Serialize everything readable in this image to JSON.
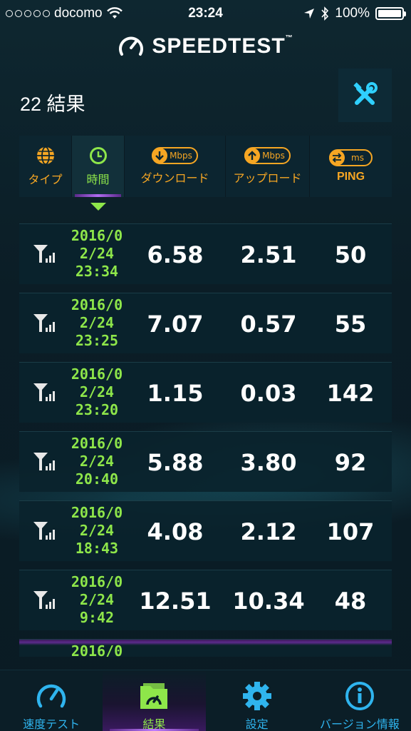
{
  "status_bar": {
    "carrier": "docomo",
    "time": "23:24",
    "battery": "100%"
  },
  "header": {
    "brand": "SPEEDTEST",
    "tm": "™",
    "result_count": "22 結果"
  },
  "columns": [
    {
      "label": "タイプ",
      "icon": "globe-icon"
    },
    {
      "label": "時間",
      "icon": "clock-icon",
      "active": true
    },
    {
      "label": "ダウンロード",
      "icon": "download-icon",
      "unit": "Mbps"
    },
    {
      "label": "アップロード",
      "icon": "upload-icon",
      "unit": "Mbps"
    },
    {
      "label": "PING",
      "icon": "ping-icon",
      "unit": "ms"
    }
  ],
  "results": [
    {
      "date1": "2016/0",
      "date2": "2/24",
      "time": "23:34",
      "download": "6.58",
      "upload": "2.51",
      "ping": "50"
    },
    {
      "date1": "2016/0",
      "date2": "2/24",
      "time": "23:25",
      "download": "7.07",
      "upload": "0.57",
      "ping": "55"
    },
    {
      "date1": "2016/0",
      "date2": "2/24",
      "time": "23:20",
      "download": "1.15",
      "upload": "0.03",
      "ping": "142"
    },
    {
      "date1": "2016/0",
      "date2": "2/24",
      "time": "20:40",
      "download": "5.88",
      "upload": "3.80",
      "ping": "92"
    },
    {
      "date1": "2016/0",
      "date2": "2/24",
      "time": "18:43",
      "download": "4.08",
      "upload": "2.12",
      "ping": "107"
    },
    {
      "date1": "2016/0",
      "date2": "2/24",
      "time": "9:42",
      "download": "12.51",
      "upload": "10.34",
      "ping": "48"
    }
  ],
  "partial_row": {
    "date1": "2016/0"
  },
  "tabs": [
    {
      "label": "速度テスト",
      "icon": "speedometer-icon"
    },
    {
      "label": "結果",
      "icon": "results-folder-icon",
      "active": true
    },
    {
      "label": "設定",
      "icon": "gear-icon"
    },
    {
      "label": "バージョン情報",
      "icon": "info-icon"
    }
  ],
  "colors": {
    "accent_green": "#8ee64a",
    "accent_orange": "#f6a623",
    "accent_blue": "#2fb4ee",
    "accent_purple": "#b06cf0"
  }
}
